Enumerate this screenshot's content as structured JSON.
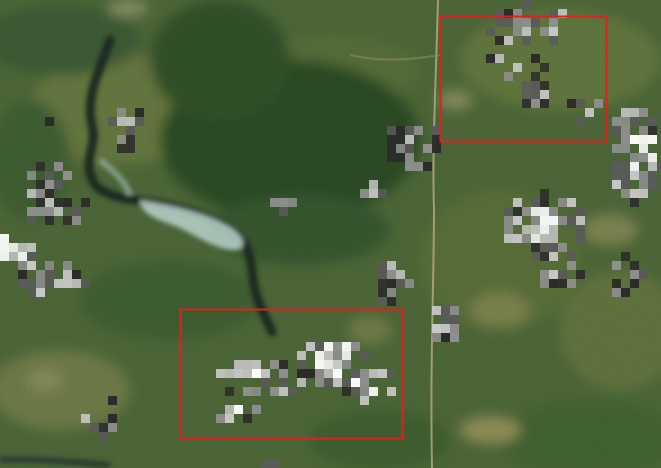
{
  "map": {
    "kind": "satellite-imagery",
    "terrain_colors": {
      "forest_dark": "#24431f",
      "forest_mid": "#3f5d2e",
      "grass": "#6d7a3f",
      "meadow": "#8a8a52",
      "bare_soil": "#a89a62",
      "water": "#1a2a22",
      "ice": "#b8cfc9"
    },
    "overlay": {
      "description_type": "pixelated grayscale heatmap blocks",
      "colors": [
        "#ffffff",
        "#c8c8c8",
        "#909090",
        "#5a5a5a",
        "#2a2a2a"
      ]
    },
    "annotations": [
      {
        "name": "highlight-box-1",
        "color": "#e02020"
      },
      {
        "name": "highlight-box-2",
        "color": "#e02020"
      }
    ]
  }
}
